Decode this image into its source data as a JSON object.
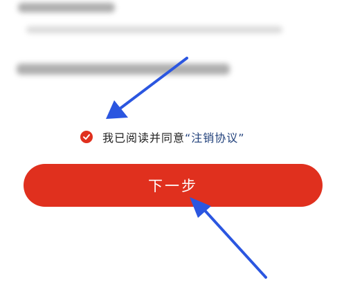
{
  "agreement": {
    "text": "我已阅读并同意",
    "link": "“注销协议”"
  },
  "next_button": {
    "label": "下一步"
  },
  "colors": {
    "accent": "#e0301e",
    "link": "#1f3f7a",
    "arrow": "#2b56e0"
  },
  "icons": {
    "checkbox": "check-circle-icon",
    "annotation": "arrow-icon"
  }
}
